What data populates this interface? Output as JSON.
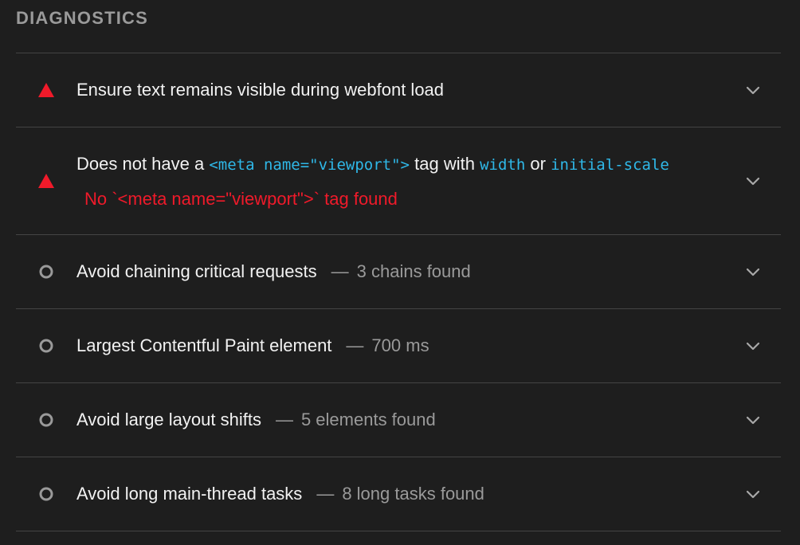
{
  "section": {
    "title": "DIAGNOSTICS"
  },
  "colors": {
    "fail": "#f01a2a",
    "neutral": "#9a9a9a",
    "code": "#2fb8e8",
    "background": "#1e1e1e",
    "divider": "#444444"
  },
  "audits": [
    {
      "status_icon": "fail-triangle-icon",
      "title": "Ensure text remains visible during webfont load"
    },
    {
      "status_icon": "fail-triangle-icon",
      "title_parts": {
        "text1": "Does not have a ",
        "code1": "<meta name=\"viewport\">",
        "text2": " tag with ",
        "code2": "width",
        "text3": " or ",
        "code3": "initial-scale"
      },
      "error": "No `<meta name=\"viewport\">` tag found"
    },
    {
      "status_icon": "informative-circle-icon",
      "title": "Avoid chaining critical requests",
      "separator": "—",
      "detail": "3 chains found"
    },
    {
      "status_icon": "informative-circle-icon",
      "title": "Largest Contentful Paint element",
      "separator": "—",
      "detail": "700 ms"
    },
    {
      "status_icon": "informative-circle-icon",
      "title": "Avoid large layout shifts",
      "separator": "—",
      "detail": "5 elements found"
    },
    {
      "status_icon": "informative-circle-icon",
      "title": "Avoid long main-thread tasks",
      "separator": "—",
      "detail": "8 long tasks found"
    }
  ]
}
